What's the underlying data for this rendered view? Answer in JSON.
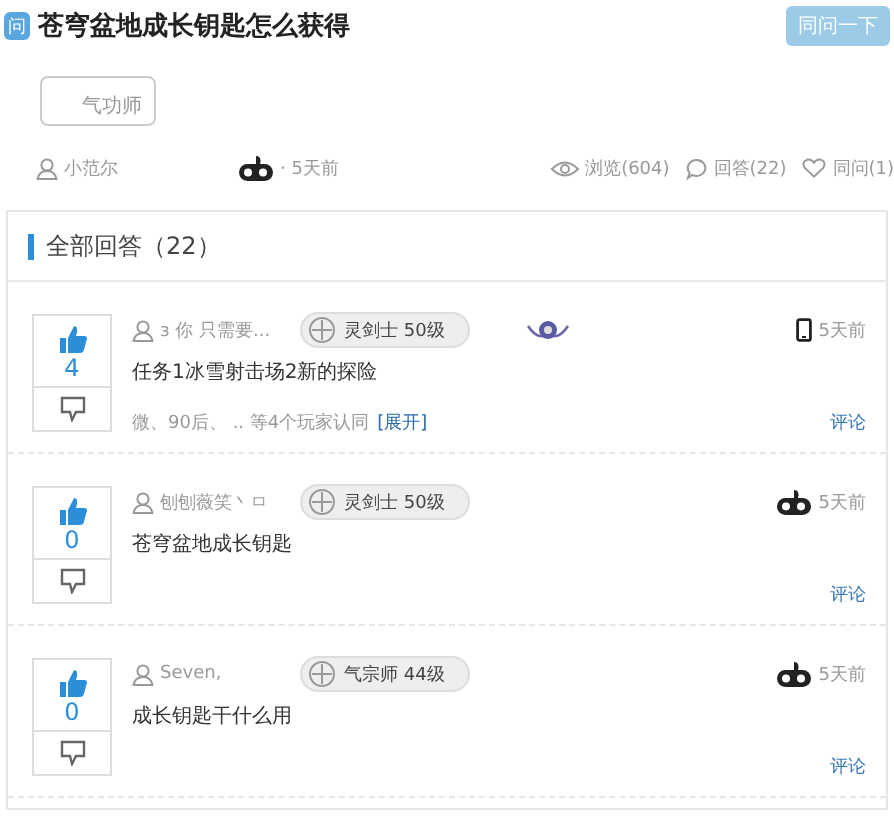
{
  "question": {
    "badge": "问",
    "title": "苍穹盆地成长钥匙怎么获得",
    "ask_button": "同问一下"
  },
  "tags": [
    "气功师"
  ],
  "meta": {
    "author": "小范尔",
    "kind": "gamepad",
    "time": "· 5天前",
    "views": "浏览(604)",
    "answers": "回答(22)",
    "same_question": "同问(1)"
  },
  "answers_header": {
    "title": "全部回答（22）"
  },
  "answers": [
    {
      "votes": "4",
      "author": "з 你 只需要...",
      "class_level": "灵剑士 50级",
      "medal": true,
      "kind": "phone",
      "time": "5天前",
      "text": "任务1冰雪射击场2新的探险",
      "endorse": "微、90后、 .. 等4个玩家认同",
      "expand": "[展开]",
      "comment": "评论"
    },
    {
      "votes": "0",
      "author": "刨刨薇笑丶ㅁ",
      "class_level": "灵剑士 50级",
      "medal": false,
      "kind": "gamepad",
      "time": "5天前",
      "text": "苍穹盆地成长钥匙",
      "comment": "评论"
    },
    {
      "votes": "0",
      "author": "Seven,",
      "class_level": "气宗师 44级",
      "medal": false,
      "kind": "gamepad",
      "time": "5天前",
      "text": "成长钥匙干什么用",
      "comment": "评论"
    }
  ]
}
